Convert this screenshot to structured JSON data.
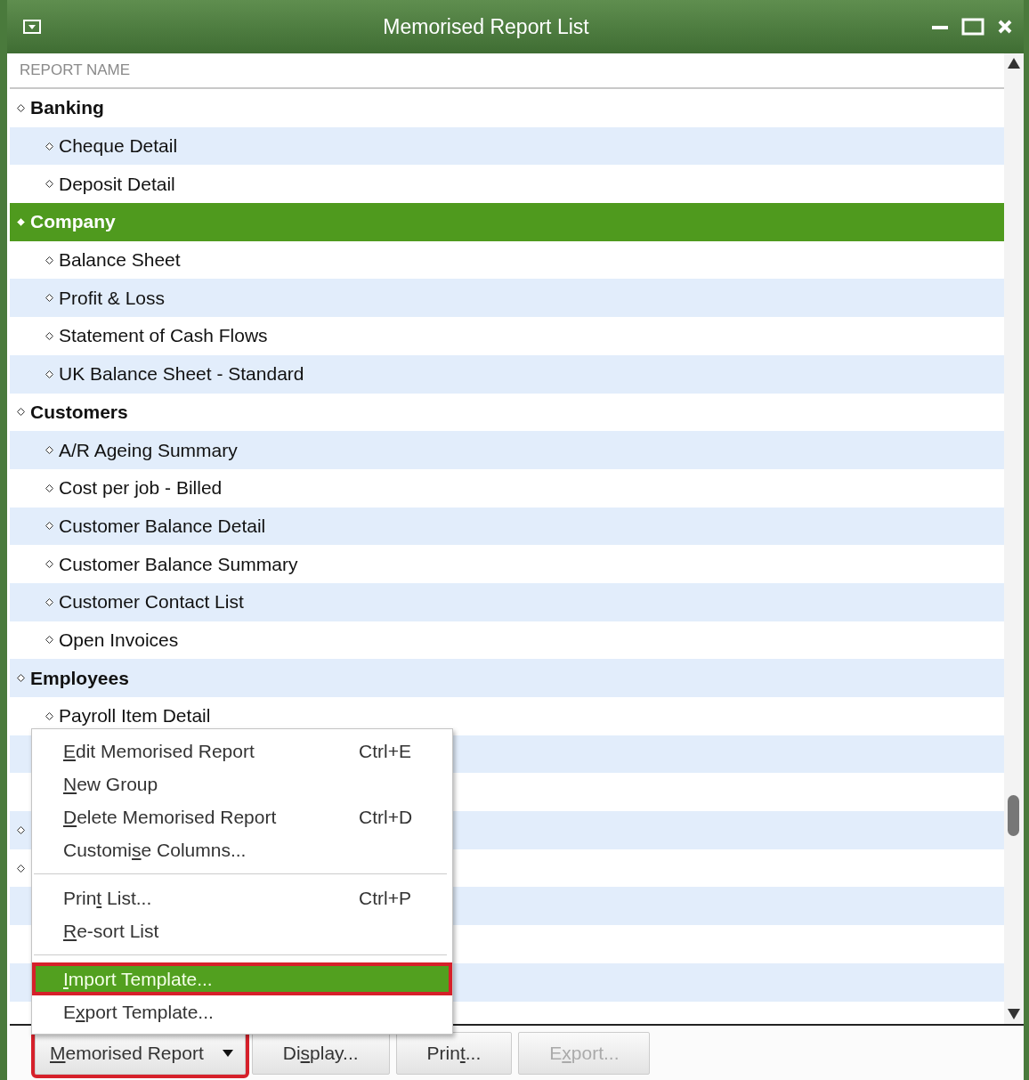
{
  "window": {
    "title": "Memorised Report List"
  },
  "table": {
    "columns": [
      "REPORT NAME"
    ],
    "rows": [
      {
        "kind": "group",
        "label": "Banking",
        "selected": false
      },
      {
        "kind": "report",
        "label": "Cheque Detail",
        "selected": false
      },
      {
        "kind": "report",
        "label": "Deposit Detail",
        "selected": false
      },
      {
        "kind": "group",
        "label": "Company",
        "selected": true
      },
      {
        "kind": "report",
        "label": "Balance Sheet",
        "selected": false
      },
      {
        "kind": "report",
        "label": "Profit & Loss",
        "selected": false
      },
      {
        "kind": "report",
        "label": "Statement of Cash Flows",
        "selected": false
      },
      {
        "kind": "report",
        "label": "UK Balance Sheet - Standard",
        "selected": false
      },
      {
        "kind": "group",
        "label": "Customers",
        "selected": false
      },
      {
        "kind": "report",
        "label": "A/R Ageing Summary",
        "selected": false
      },
      {
        "kind": "report",
        "label": "Cost per job - Billed",
        "selected": false
      },
      {
        "kind": "report",
        "label": "Customer Balance Detail",
        "selected": false
      },
      {
        "kind": "report",
        "label": "Customer Balance Summary",
        "selected": false
      },
      {
        "kind": "report",
        "label": "Customer Contact List",
        "selected": false
      },
      {
        "kind": "report",
        "label": "Open Invoices",
        "selected": false
      },
      {
        "kind": "group",
        "label": "Employees",
        "selected": false
      },
      {
        "kind": "report",
        "label": "Payroll Item Detail",
        "selected": false
      },
      {
        "kind": "report"
      },
      {
        "kind": "report"
      },
      {
        "kind": "group"
      },
      {
        "kind": "group"
      },
      {
        "kind": "report"
      },
      {
        "kind": "report"
      },
      {
        "kind": "report"
      },
      {
        "kind": "report"
      }
    ]
  },
  "context_menu": {
    "sections": [
      [
        {
          "key": "E",
          "after": "dit Memorised Report",
          "shortcut": "Ctrl+E",
          "selected": false,
          "highlighted": false
        },
        {
          "key": "N",
          "after": "ew Group",
          "selected": false,
          "highlighted": false
        },
        {
          "key": "D",
          "after": "elete Memorised Report",
          "shortcut": "Ctrl+D",
          "selected": false,
          "highlighted": false
        },
        {
          "before": "Customi",
          "key": "s",
          "after": "e Columns...",
          "selected": false,
          "highlighted": false
        }
      ],
      [
        {
          "before": "Prin",
          "key": "t",
          "after": " List...",
          "shortcut": "Ctrl+P",
          "selected": false,
          "highlighted": false
        },
        {
          "key": "R",
          "after": "e-sort List",
          "selected": false,
          "highlighted": false
        }
      ],
      [
        {
          "key": "I",
          "after": "mport Template...",
          "selected": true,
          "highlighted": true
        },
        {
          "before": "E",
          "key": "x",
          "after": "port Template...",
          "selected": false,
          "highlighted": false
        }
      ]
    ]
  },
  "buttons": [
    {
      "kind": "dropdown",
      "key": "M",
      "after": "emorised Report",
      "disabled": false,
      "highlighted": true
    },
    {
      "kind": "plain",
      "before": "Di",
      "key": "s",
      "after": "play...",
      "disabled": false,
      "highlighted": false
    },
    {
      "kind": "plain",
      "before": "Prin",
      "key": "t",
      "after": "...",
      "disabled": false,
      "highlighted": false
    },
    {
      "kind": "plain",
      "before": "E",
      "key": "x",
      "after": "port...",
      "disabled": true,
      "highlighted": false
    }
  ]
}
